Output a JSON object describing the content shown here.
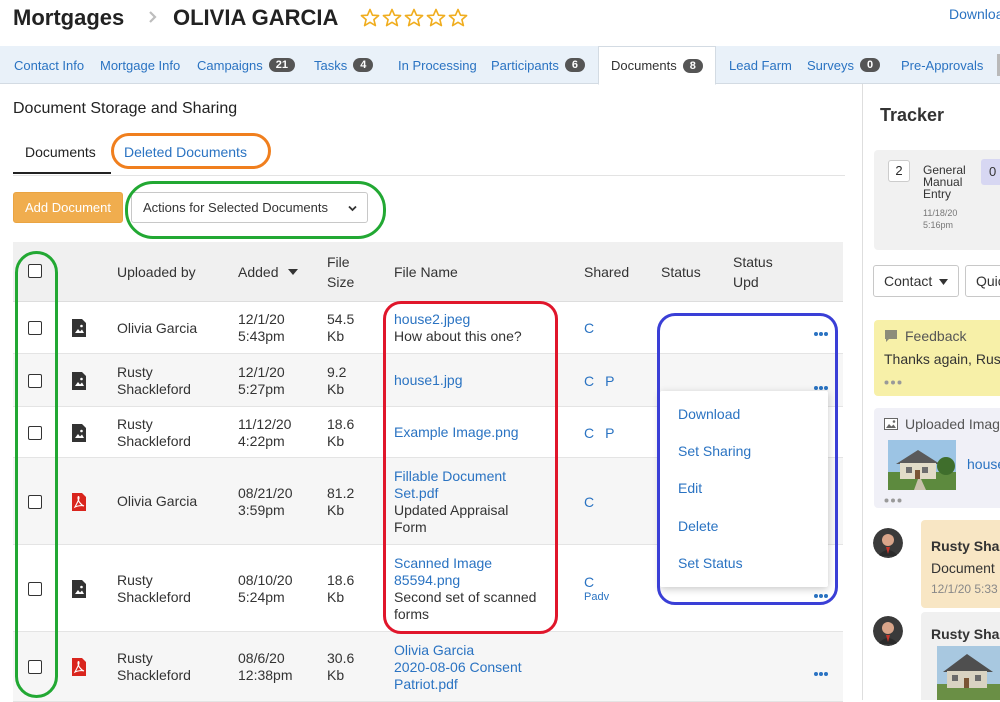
{
  "header": {
    "breadcrumb_root": "Mortgages",
    "client_name": "OLIVIA GARCIA",
    "rating": {
      "value": 0,
      "max": 5
    },
    "download_link": "Download"
  },
  "tabs": [
    {
      "label": "Contact Info",
      "badge": ""
    },
    {
      "label": "Mortgage Info",
      "badge": ""
    },
    {
      "label": "Campaigns",
      "badge": "21"
    },
    {
      "label": "Tasks",
      "badge": "4"
    },
    {
      "label": "In Processing",
      "badge": ""
    },
    {
      "label": "Participants",
      "badge": "6"
    },
    {
      "label": "Documents",
      "badge": "8",
      "active": true
    },
    {
      "label": "Lead Farm",
      "badge": ""
    },
    {
      "label": "Surveys",
      "badge": "0"
    },
    {
      "label": "Pre-Approvals",
      "badge": ""
    }
  ],
  "main": {
    "title": "Document Storage and Sharing",
    "subtabs": {
      "documents": "Documents",
      "deleted": "Deleted Documents"
    },
    "add_button": "Add Document",
    "actions_button": "Actions for Selected Documents"
  },
  "table": {
    "headers": {
      "uploaded_by": "Uploaded by",
      "added": "Added",
      "file_size": [
        "File",
        "Size"
      ],
      "file_name": "File Name",
      "shared": "Shared",
      "status": "Status",
      "status_upd": [
        "Status",
        "Upd"
      ]
    },
    "rows": [
      {
        "icon": "image-file-icon",
        "uploader": [
          "Olivia Garcia"
        ],
        "added": [
          "12/1/20",
          "5:43pm"
        ],
        "size": [
          "54.5",
          "Kb"
        ],
        "file_link": [
          "house2.jpeg"
        ],
        "description": [
          "How about this one?"
        ],
        "shared": [
          "C"
        ]
      },
      {
        "icon": "image-file-icon",
        "uploader": [
          "Rusty",
          "Shackleford"
        ],
        "added": [
          "12/1/20",
          "5:27pm"
        ],
        "size": [
          "9.2",
          "Kb"
        ],
        "file_link": [
          "house1.jpg"
        ],
        "description": [],
        "shared": [
          "C",
          "P"
        ]
      },
      {
        "icon": "image-file-icon",
        "uploader": [
          "Rusty",
          "Shackleford"
        ],
        "added": [
          "11/12/20",
          "4:22pm"
        ],
        "size": [
          "18.6",
          "Kb"
        ],
        "file_link": [
          "Example Image.png"
        ],
        "description": [],
        "shared": [
          "C",
          "P"
        ]
      },
      {
        "icon": "pdf-file-icon",
        "uploader": [
          "Olivia Garcia"
        ],
        "added": [
          "08/21/20",
          "3:59pm"
        ],
        "size": [
          "81.2",
          "Kb"
        ],
        "file_link": [
          "Fillable Document",
          "Set.pdf"
        ],
        "description": [
          "Updated Appraisal",
          "Form"
        ],
        "shared": [
          "C"
        ]
      },
      {
        "icon": "image-file-icon",
        "uploader": [
          "Rusty",
          "Shackleford"
        ],
        "added": [
          "08/10/20",
          "5:24pm"
        ],
        "size": [
          "18.6",
          "Kb"
        ],
        "file_link": [
          "Scanned Image",
          "85594.png"
        ],
        "description": [
          "Second set of scanned",
          "forms"
        ],
        "shared": [
          "C"
        ],
        "shared_extra": "Padv"
      },
      {
        "icon": "pdf-file-icon",
        "uploader": [
          "Rusty",
          "Shackleford"
        ],
        "added": [
          "08/6/20",
          "12:38pm"
        ],
        "size": [
          "30.6",
          "Kb"
        ],
        "file_link": [
          "Olivia Garcia",
          "2020-08-06 Consent",
          "Patriot.pdf"
        ],
        "description": [],
        "shared": []
      }
    ]
  },
  "row_menu": [
    "Download",
    "Set Sharing",
    "Edit",
    "Delete",
    "Set Status"
  ],
  "tracker": {
    "title": "Tracker",
    "stage_count": "2",
    "stage_label": [
      "General",
      "Manual",
      "Entry"
    ],
    "stage_time": [
      "11/18/20",
      "5:16pm"
    ],
    "stage_other_count": "0",
    "contact_button": "Contact",
    "quick_button": "Quic",
    "feedback_title": "Feedback",
    "feedback_text": "Thanks again, Rus",
    "upload_title": "Uploaded Image",
    "upload_link": "house",
    "message1": {
      "author": "Rusty Shac",
      "text": "Document",
      "time": "12/1/20 5:33"
    },
    "message2": {
      "author": "Rusty Shac"
    }
  },
  "colors": {
    "link": "#2a73c2",
    "add_button": "#f0ad4e",
    "tab_bar": "#e9f1f9",
    "badge": "#555555",
    "annotation_orange": "#f07f1e",
    "annotation_green": "#22a833",
    "annotation_red": "#e0162b",
    "annotation_blue": "#3a3fd6",
    "feedback_card": "#f7f0a8",
    "pdf_icon": "#d9251d"
  }
}
